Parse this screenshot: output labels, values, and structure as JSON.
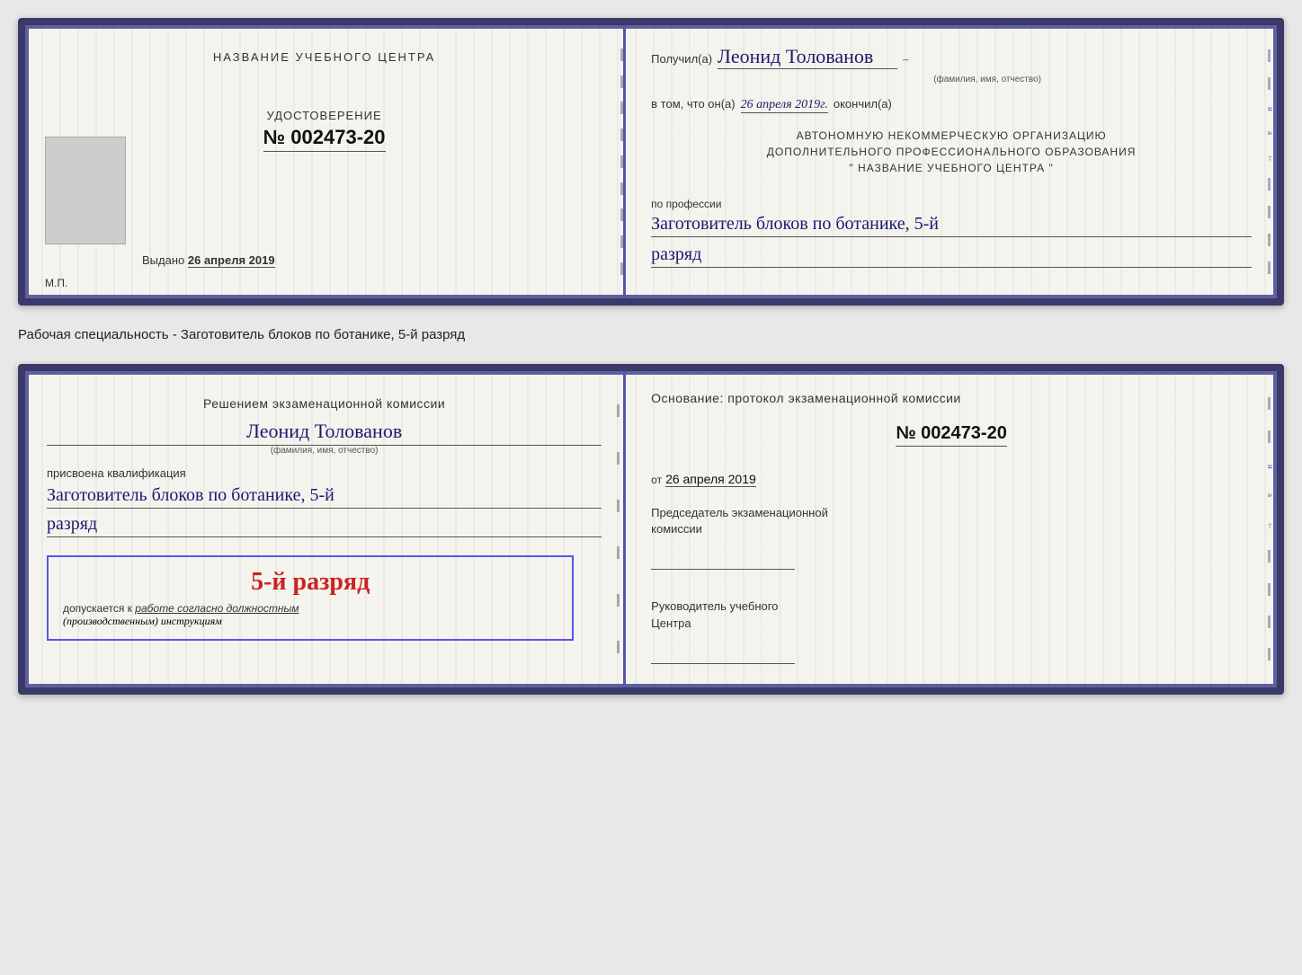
{
  "page": {
    "background": "#e8e8e8"
  },
  "specialty_text": "Рабочая специальность - Заготовитель блоков по ботанике, 5-й разряд",
  "card1": {
    "left": {
      "training_center": "НАЗВАНИЕ УЧЕБНОГО ЦЕНТРА",
      "udostoverenie_label": "УДОСТОВЕРЕНИЕ",
      "number": "№ 002473-20",
      "vydano_prefix": "Выдано",
      "vydano_date": "26 апреля 2019",
      "mp_label": "М.П."
    },
    "right": {
      "poluchil_label": "Получил(а)",
      "poluchil_name": "Леонид Толованов",
      "poluchil_dash": "–",
      "fio_subtitle": "(фамилия, имя, отчество)",
      "vtom_label": "в том, что он(а)",
      "vtom_date": "26 апреля 2019г.",
      "okoncil_label": "окончил(а)",
      "org_line1": "АВТОНОМНУЮ НЕКОММЕРЧЕСКУЮ ОРГАНИЗАЦИЮ",
      "org_line2": "ДОПОЛНИТЕЛЬНОГО ПРОФЕССИОНАЛЬНОГО ОБРАЗОВАНИЯ",
      "org_name": "\" НАЗВАНИЕ УЧЕБНОГО ЦЕНТРА \"",
      "poprofessii_label": "по профессии",
      "profession_name": "Заготовитель блоков по ботанике, 5-й",
      "razryad": "разряд"
    }
  },
  "card2": {
    "left": {
      "resheniem_label": "Решением экзаменационной комиссии",
      "name": "Леонид Толованов",
      "fio_subtitle": "(фамилия, имя, отчество)",
      "prisvoena_label": "присвоена квалификация",
      "profession_name": "Заготовитель блоков по ботанике, 5-й",
      "razryad": "разряд",
      "stamp_razryad": "5-й разряд",
      "dopuskaetsya_prefix": "допускается к",
      "dopuskaetsya_text": "работе согласно должностным",
      "instrukcii": "(производственным) инструкциям"
    },
    "right": {
      "osnovanie_label": "Основание: протокол экзаменационной комиссии",
      "protokol_number": "№ 002473-20",
      "ot_label": "от",
      "ot_date": "26 апреля 2019",
      "predsedatel_label": "Председатель экзаменационной\nкомиссии",
      "rukovoditel_label": "Руководитель учебного\nЦентра"
    }
  }
}
